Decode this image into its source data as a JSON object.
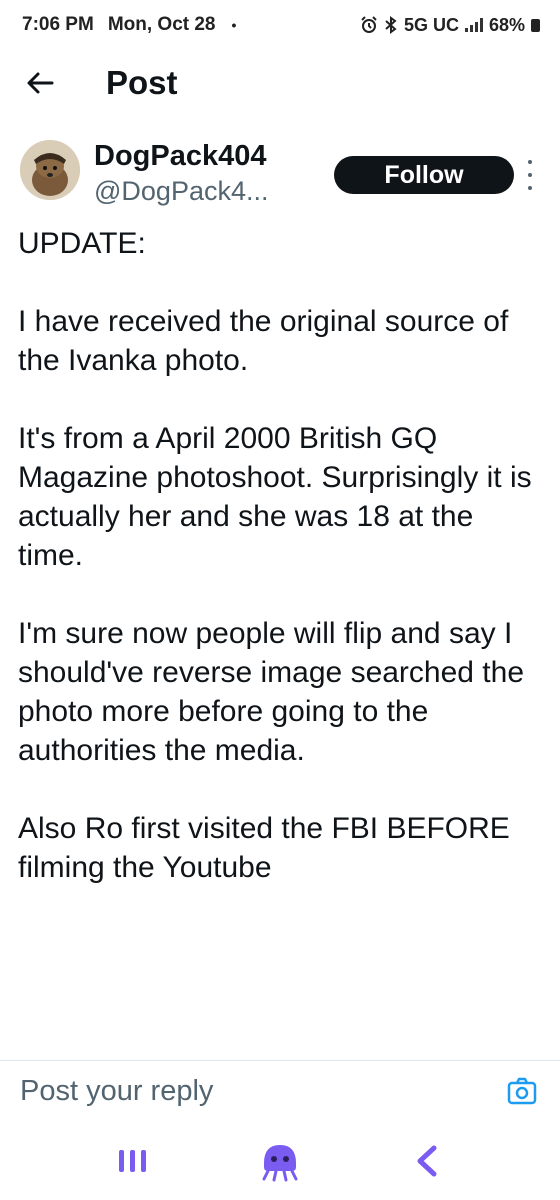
{
  "status_bar": {
    "time": "7:06 PM",
    "date": "Mon, Oct 28",
    "dot": "•",
    "network": "5G UC",
    "battery": "68%"
  },
  "header": {
    "title": "Post",
    "back_icon": "arrow-left-icon"
  },
  "post": {
    "author": {
      "display_name": "DogPack404",
      "handle": "@DogPack4..."
    },
    "follow_label": "Follow",
    "text": "UPDATE:\n\nI have received the original source of the Ivanka photo.\n\nIt's from a April 2000 British GQ Magazine photoshoot. Surprisingly it is actually her and she was 18 at the time.\n\nI'm sure now people will flip and say I should've reverse image searched the photo more before going to the authorities the media.\n\nAlso Ro first visited the FBI BEFORE filming the Youtube"
  },
  "reply": {
    "placeholder": "Post your reply",
    "camera_icon": "camera-icon"
  },
  "nav": {
    "recents_icon": "recents-icon",
    "home_icon": "assistant-icon",
    "back_icon": "back-chevron-icon"
  },
  "colors": {
    "accent_blue": "#1d9bf0",
    "nav_purple": "#7b5cf0",
    "text": "#0f1419",
    "secondary": "#536471"
  }
}
